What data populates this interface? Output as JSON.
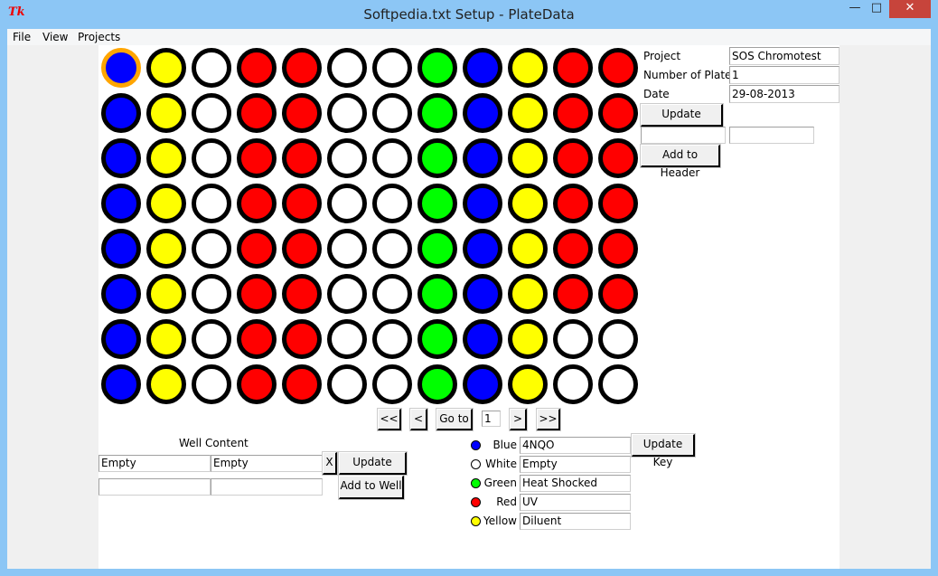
{
  "window": {
    "title": "Softpedia.txt Setup - PlateData",
    "icon": "tk-icon",
    "minimize": "—",
    "maximize": "□",
    "close": "✕"
  },
  "menu": [
    "File",
    "View",
    "Projects"
  ],
  "colors": {
    "Blue": "#0000ff",
    "White": "#ffffff",
    "Green": "#00ff00",
    "Red": "#ff0000",
    "Yellow": "#ffff00",
    "selected": "#ffa500"
  },
  "plate": {
    "rows": [
      [
        "Blue",
        "Yellow",
        "White",
        "Red",
        "Red",
        "White",
        "White",
        "Green",
        "Blue",
        "Yellow",
        "Red",
        "Red"
      ],
      [
        "Blue",
        "Yellow",
        "White",
        "Red",
        "Red",
        "White",
        "White",
        "Green",
        "Blue",
        "Yellow",
        "Red",
        "Red"
      ],
      [
        "Blue",
        "Yellow",
        "White",
        "Red",
        "Red",
        "White",
        "White",
        "Green",
        "Blue",
        "Yellow",
        "Red",
        "Red"
      ],
      [
        "Blue",
        "Yellow",
        "White",
        "Red",
        "Red",
        "White",
        "White",
        "Green",
        "Blue",
        "Yellow",
        "Red",
        "Red"
      ],
      [
        "Blue",
        "Yellow",
        "White",
        "Red",
        "Red",
        "White",
        "White",
        "Green",
        "Blue",
        "Yellow",
        "Red",
        "Red"
      ],
      [
        "Blue",
        "Yellow",
        "White",
        "Red",
        "Red",
        "White",
        "White",
        "Green",
        "Blue",
        "Yellow",
        "Red",
        "Red"
      ],
      [
        "Blue",
        "Yellow",
        "White",
        "Red",
        "Red",
        "White",
        "White",
        "Green",
        "Blue",
        "Yellow",
        "White",
        "White"
      ],
      [
        "Blue",
        "Yellow",
        "White",
        "Red",
        "Red",
        "White",
        "White",
        "Green",
        "Blue",
        "Yellow",
        "White",
        "White"
      ]
    ],
    "selected": [
      0,
      0
    ]
  },
  "header": {
    "project_label": "Project",
    "project_value": "SOS Chromotest",
    "plates_label": "Number of Plates",
    "plates_value": "1",
    "date_label": "Date",
    "date_value": "29-08-2013",
    "update_header": "Update Header",
    "new_key": "",
    "new_value": "",
    "add_to_header": "Add to Header"
  },
  "nav": {
    "first": "<<",
    "prev": "<",
    "goto": "Go to",
    "page": "1",
    "next": ">",
    "last": ">>"
  },
  "well": {
    "title": "Well Content",
    "row1": [
      "Empty",
      "Empty"
    ],
    "row2": [
      "",
      ""
    ],
    "clear": "X",
    "update": "Update Well",
    "add": "Add to Well"
  },
  "key": {
    "items": [
      {
        "color": "Blue",
        "label": "Blue",
        "value": "4NQO"
      },
      {
        "color": "White",
        "label": "White",
        "value": "Empty"
      },
      {
        "color": "Green",
        "label": "Green",
        "value": "Heat Shocked"
      },
      {
        "color": "Red",
        "label": "Red",
        "value": "UV"
      },
      {
        "color": "Yellow",
        "label": "Yellow",
        "value": "Diluent"
      }
    ],
    "update": "Update Key"
  }
}
